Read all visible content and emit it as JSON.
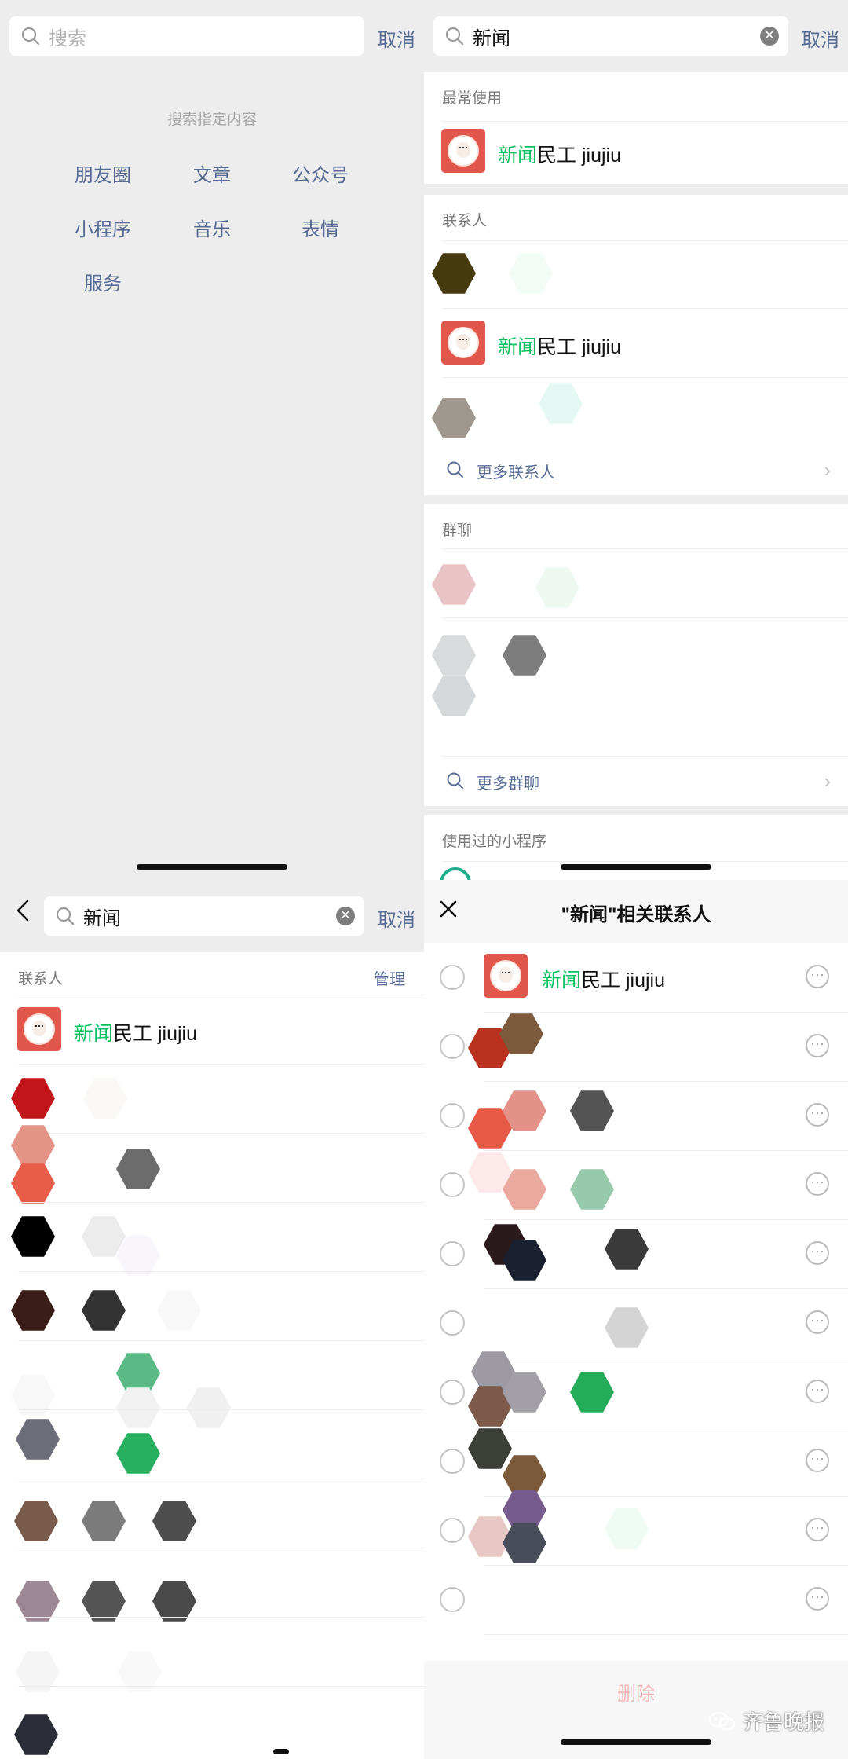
{
  "top_left": {
    "search_placeholder": "搜索",
    "cancel": "取消",
    "hint": "搜索指定内容",
    "categories": [
      "朋友圈",
      "文章",
      "公众号",
      "小程序",
      "音乐",
      "表情",
      "服务"
    ]
  },
  "top_right": {
    "search_value": "新闻",
    "cancel": "取消",
    "sections": {
      "most_used": "最常使用",
      "contacts": "联系人",
      "groups": "群聊",
      "mini_programs": "使用过的小程序"
    },
    "result_highlight": "新闻",
    "result_rest": "民工 jiujiu",
    "more_contacts": "更多联系人",
    "more_groups": "更多群聊"
  },
  "bottom_left": {
    "search_value": "新闻",
    "cancel": "取消",
    "section_title": "联系人",
    "manage": "管理",
    "result_highlight": "新闻",
    "result_rest": "民工 jiujiu"
  },
  "bottom_right": {
    "title": "\"新闻\"相关联系人",
    "result_highlight": "新闻",
    "result_rest": "民工 jiujiu",
    "delete": "删除"
  },
  "watermark": "齐鲁晚报",
  "colors": {
    "link": "#576b95",
    "highlight": "#07c160",
    "avatar": "#e2574b",
    "background": "#ededed"
  },
  "icons": [
    "search-icon",
    "clear-icon",
    "chevron-right-icon",
    "back-icon",
    "close-icon",
    "more-icon",
    "radio-icon"
  ]
}
